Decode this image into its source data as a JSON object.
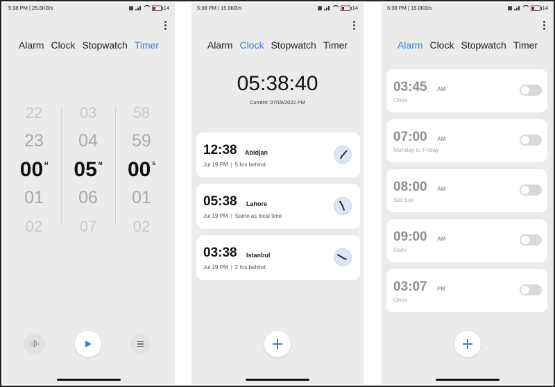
{
  "status_bars": [
    {
      "left": "5:38 PM | 25.6KB/s",
      "battery": "14"
    },
    {
      "left": "5:38 PM | 15.0KB/s",
      "battery": "14"
    },
    {
      "left": "5:38 PM | 15.0KB/s",
      "battery": "14"
    }
  ],
  "tabs": {
    "alarm": "Alarm",
    "clock": "Clock",
    "stopwatch": "Stopwatch",
    "timer": "Timer"
  },
  "timer": {
    "hours": {
      "prev2": "22",
      "prev1": "23",
      "selected": "00",
      "next1": "01",
      "next2": "02",
      "unit": "H"
    },
    "minutes": {
      "prev2": "03",
      "prev1": "04",
      "selected": "05",
      "next1": "06",
      "next2": "07",
      "unit": "M"
    },
    "seconds": {
      "prev2": "58",
      "prev1": "59",
      "selected": "00",
      "next1": "01",
      "next2": "02",
      "unit": "S"
    }
  },
  "clock": {
    "time": "05:38:40",
    "current": "Current: 07/19/2022 PM",
    "world": [
      {
        "time": "12:38",
        "city": "Abidjan",
        "date": "Jul 19 PM",
        "diff": "5 hrs behind"
      },
      {
        "time": "05:38",
        "city": "Lahore",
        "date": "Jul 19 PM",
        "diff": "Same as local time"
      },
      {
        "time": "03:38",
        "city": "Istanbul",
        "date": "Jul 19 PM",
        "diff": "2 hrs behind"
      }
    ]
  },
  "alarms": [
    {
      "time": "03:45",
      "ampm": "AM",
      "repeat": "Once",
      "enabled": false
    },
    {
      "time": "07:00",
      "ampm": "AM",
      "repeat": "Monday to Friday",
      "enabled": false
    },
    {
      "time": "08:00",
      "ampm": "AM",
      "repeat": "Sat Sun",
      "enabled": false
    },
    {
      "time": "09:00",
      "ampm": "AM",
      "repeat": "Daily",
      "enabled": false
    },
    {
      "time": "03:07",
      "ampm": "PM",
      "repeat": "Once",
      "enabled": false
    }
  ],
  "icons": {
    "accent": "#3a7ee0",
    "play": "play-icon",
    "sound": "sound-wave-icon",
    "list": "list-icon",
    "add": "plus-icon",
    "more": "more-vertical-icon"
  }
}
